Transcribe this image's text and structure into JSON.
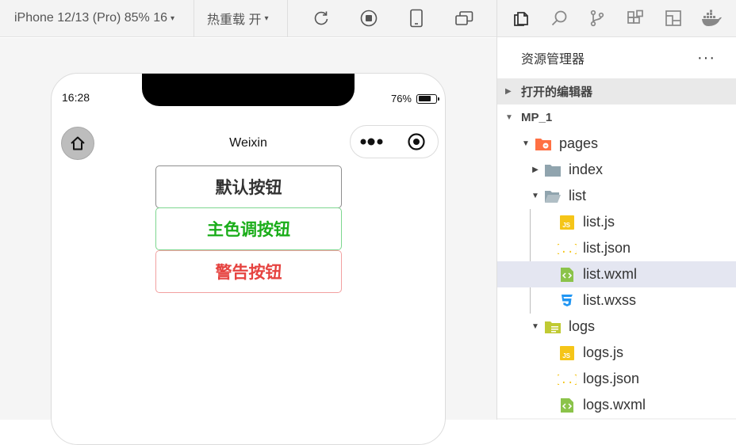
{
  "toolbar": {
    "device_label": "iPhone 12/13 (Pro) 85% 16",
    "hot_reload_label": "热重载 开",
    "caret": "▾",
    "icons": [
      "refresh-icon",
      "stop-icon",
      "phone-icon",
      "multi-window-icon"
    ]
  },
  "phone": {
    "time": "16:28",
    "battery_text": "76%",
    "battery_level": 0.76,
    "nav_title": "Weixin",
    "buttons": {
      "default_label": "默认按钮",
      "primary_label": "主色调按钮",
      "warn_label": "警告按钮"
    }
  },
  "panel": {
    "activity_icons": [
      "files-icon",
      "search-icon",
      "source-control-icon",
      "extensions-icon",
      "layout-icon",
      "docker-icon"
    ],
    "explorer_title": "资源管理器",
    "more": "···",
    "open_editors_label": "打开的编辑器",
    "project_label": "MP_1",
    "tree": [
      {
        "label": "pages",
        "type": "folder-pages"
      },
      {
        "label": "index",
        "type": "folder"
      },
      {
        "label": "list",
        "type": "folder-open"
      },
      {
        "label": "list.js",
        "type": "js"
      },
      {
        "label": "list.json",
        "type": "json"
      },
      {
        "label": "list.wxml",
        "type": "wxml"
      },
      {
        "label": "list.wxss",
        "type": "css"
      },
      {
        "label": "logs",
        "type": "folder-logs"
      },
      {
        "label": "logs.js",
        "type": "js"
      },
      {
        "label": "logs.json",
        "type": "json"
      },
      {
        "label": "logs.wxml",
        "type": "wxml"
      }
    ]
  },
  "colors": {
    "primary_green": "#1aad19",
    "warn_red": "#e64340",
    "selected_row": "#e4e6f1",
    "js_yellow": "#f5c518",
    "wxml_green": "#8bc34a",
    "css_blue": "#2196f3"
  }
}
